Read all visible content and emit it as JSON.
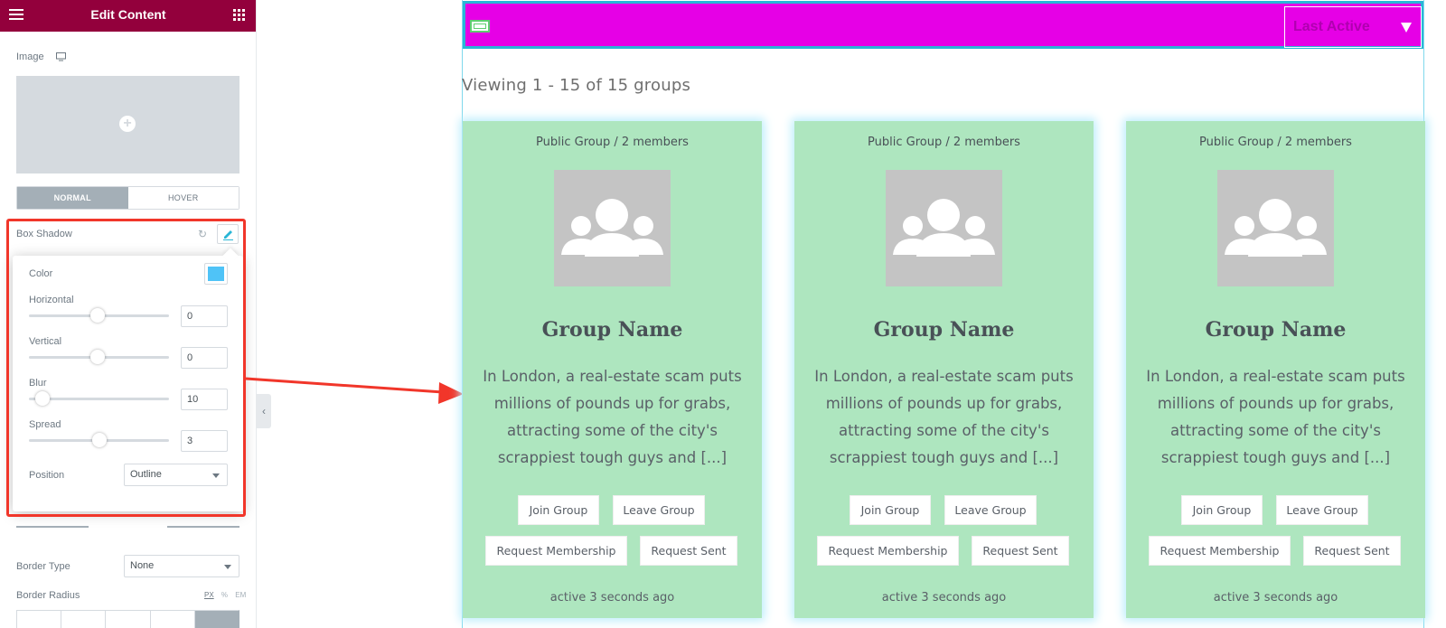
{
  "editor": {
    "title": "Edit Content",
    "image_label": "Image",
    "tabs": {
      "normal": "NORMAL",
      "hover": "HOVER"
    },
    "box_shadow_label": "Box Shadow",
    "popover": {
      "color_label": "Color",
      "color_value": "#4fc3f7",
      "horizontal_label": "Horizontal",
      "horizontal_value": "0",
      "vertical_label": "Vertical",
      "vertical_value": "0",
      "blur_label": "Blur",
      "blur_value": "10",
      "spread_label": "Spread",
      "spread_value": "3",
      "position_label": "Position",
      "position_value": "Outline"
    },
    "border_type_label": "Border Type",
    "border_type_value": "None",
    "border_radius_label": "Border Radius",
    "units": [
      "PX",
      "%",
      "EM"
    ],
    "header_color": "#93003c"
  },
  "preview": {
    "order_select": "Last Active",
    "viewing_text": "Viewing 1 - 15 of 15 groups",
    "toolbar_color": "#e600e6",
    "card_color": "#aee6bf",
    "cards": [
      {
        "meta": "Public Group / 2 members",
        "name": "Group Name",
        "description": "In London, a real-estate scam puts millions of pounds up for grabs, attracting some of the city's scrappiest tough guys and [...]",
        "buttons": {
          "join": "Join Group",
          "leave": "Leave Group",
          "request": "Request Membership",
          "sent": "Request Sent"
        },
        "active": "active 3 seconds ago"
      },
      {
        "meta": "Public Group / 2 members",
        "name": "Group Name",
        "description": "In London, a real-estate scam puts millions of pounds up for grabs, attracting some of the city's scrappiest tough guys and [...]",
        "buttons": {
          "join": "Join Group",
          "leave": "Leave Group",
          "request": "Request Membership",
          "sent": "Request Sent"
        },
        "active": "active 3 seconds ago"
      },
      {
        "meta": "Public Group / 2 members",
        "name": "Group Name",
        "description": "In London, a real-estate scam puts millions of pounds up for grabs, attracting some of the city's scrappiest tough guys and [...]",
        "buttons": {
          "join": "Join Group",
          "leave": "Leave Group",
          "request": "Request Membership",
          "sent": "Request Sent"
        },
        "active": "active 3 seconds ago"
      }
    ]
  }
}
